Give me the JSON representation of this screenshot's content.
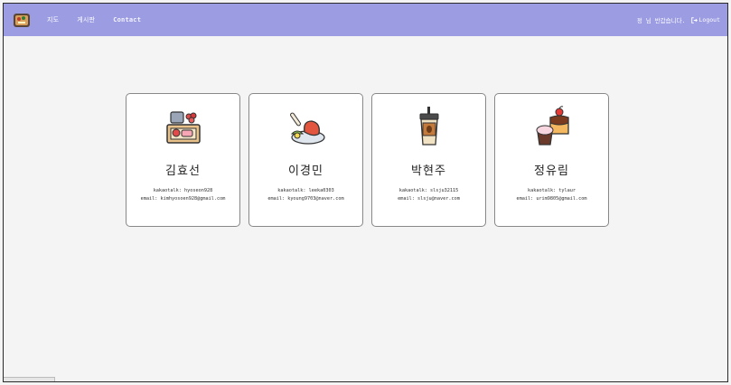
{
  "nav": {
    "links": [
      "지도",
      "게시판",
      "Contact"
    ],
    "active_index": 2,
    "greeting": "정 님 반갑습니다.",
    "logout_label": "Logout"
  },
  "cards": [
    {
      "icon": "lunchbox-icon",
      "name": "김효선",
      "kakao": "kakaotalk: hyoseon928",
      "email": "email: kimhyosoen928@gmail.com"
    },
    {
      "icon": "chicken-plate-icon",
      "name": "이경민",
      "kakao": "kakaotalk: leeka0303",
      "email": "email: kyoung9703@naver.com"
    },
    {
      "icon": "bubble-tea-icon",
      "name": "박현주",
      "kakao": "kakaotalk: slsju32115",
      "email": "email: slsju@naver.com"
    },
    {
      "icon": "cake-icon",
      "name": "정유림",
      "kakao": "kakaotalk: tylaur",
      "email": "email: urim9805@gmail.com"
    }
  ],
  "colors": {
    "navbar": "#9c9ce3",
    "background": "#f4f4f4",
    "card": "#ffffff"
  }
}
